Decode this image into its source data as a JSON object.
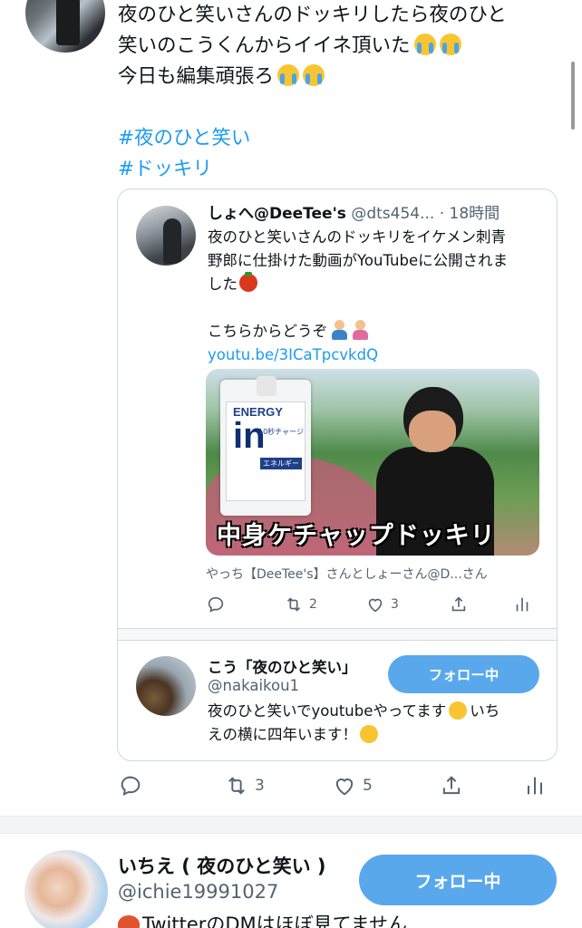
{
  "tweet": {
    "lines": [
      "夜のひと笑いさんのドッキリしたら夜のひと",
      "笑いのこうくんからイイネ頂いた",
      "今日も編集頑張ろ"
    ],
    "hashtags": [
      "#夜のひと笑い",
      "#ドッキリ"
    ],
    "actions": {
      "retweets": "3",
      "likes": "5"
    }
  },
  "quote": {
    "author_name": "しょへ@DeeTee's",
    "author_handle": "@dts454...",
    "time": "· 18時間",
    "body_lines": [
      "夜のひと笑いさんのドッキリをイケメン刺青",
      "野郎に仕掛けた動画がYouTubeに公開されま",
      "した"
    ],
    "cta": "こちらからどうぞ",
    "link": "youtu.be/3ICaTpcvkdQ",
    "video": {
      "caption": "中身ケチャップドッキリ",
      "pack_brand": "ENERGY",
      "pack_logo": "in",
      "pack_sub": "10秒チャージ",
      "pack_tag": "エネルギー"
    },
    "source": "やっち【DeeTee's】さんとしょーさん@D...さん",
    "actions": {
      "retweets": "2",
      "likes": "3"
    }
  },
  "follow_card": {
    "name": "こう「夜のひと笑い」",
    "handle": "@nakaikou1",
    "bio_lines": [
      "夜のひと笑いでyoutubeやってます",
      "いち",
      "えの横に四年います！"
    ],
    "button": "フォロー中"
  },
  "user_row": {
    "name": "いちえ ( 夜のひと笑い )",
    "handle": "@ichie19991027",
    "bio": "TwitterのDMはほぼ見てません",
    "button": "フォロー中"
  },
  "colors": {
    "link": "#1d9bf0",
    "button": "#5aa8ec",
    "text": "#0f1419",
    "muted": "#536471",
    "border": "#cfd9de"
  }
}
